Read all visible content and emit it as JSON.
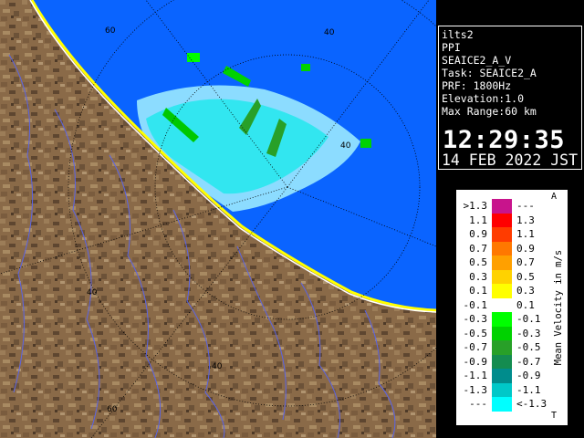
{
  "info": {
    "lines": [
      "ilts2",
      "PPI",
      "SEAICE2_A_V",
      "Task: SEAICE2_A",
      "PRF: 1800Hz",
      "Elevation:1.0",
      "Max Range:60 km"
    ],
    "time": "12:29:35",
    "date": "14 FEB 2022 JST"
  },
  "legend": {
    "axis_label": "Mean Velocity in m/s",
    "top_mark": "A",
    "bottom_mark": "T",
    "rows": [
      {
        "lo": ">1.3",
        "hi": "---",
        "color": "#c8148c"
      },
      {
        "lo": "1.1",
        "hi": "1.3",
        "color": "#ff0000"
      },
      {
        "lo": "0.9",
        "hi": "1.1",
        "color": "#ff3c00"
      },
      {
        "lo": "0.7",
        "hi": "0.9",
        "color": "#ff7800"
      },
      {
        "lo": "0.5",
        "hi": "0.7",
        "color": "#ffa000"
      },
      {
        "lo": "0.3",
        "hi": "0.5",
        "color": "#ffd200"
      },
      {
        "lo": "0.1",
        "hi": "0.3",
        "color": "#ffff00"
      },
      {
        "lo": "-0.1",
        "hi": "0.1",
        "color": "#ffffff"
      },
      {
        "lo": "-0.3",
        "hi": "-0.1",
        "color": "#00ff00"
      },
      {
        "lo": "-0.5",
        "hi": "-0.3",
        "color": "#00d200"
      },
      {
        "lo": "-0.7",
        "hi": "-0.5",
        "color": "#28a028"
      },
      {
        "lo": "-0.9",
        "hi": "-0.7",
        "color": "#148c50"
      },
      {
        "lo": "-1.1",
        "hi": "-0.9",
        "color": "#008c8c"
      },
      {
        "lo": "-1.3",
        "hi": "-1.1",
        "color": "#00c8c8"
      },
      {
        "lo": "---",
        "hi": "<-1.3",
        "color": "#00ffff"
      }
    ]
  },
  "map": {
    "range_labels": [
      "60",
      "40",
      "40",
      "40",
      "40",
      "60"
    ],
    "colors": {
      "sea": "#0a64ff",
      "land": "#8a6a48",
      "echo_light": "#8cdcff",
      "echo_mid": "#32e6f0",
      "echo_green": "#00c800",
      "rings": "#000000",
      "rivers": "#5a64e6"
    }
  }
}
